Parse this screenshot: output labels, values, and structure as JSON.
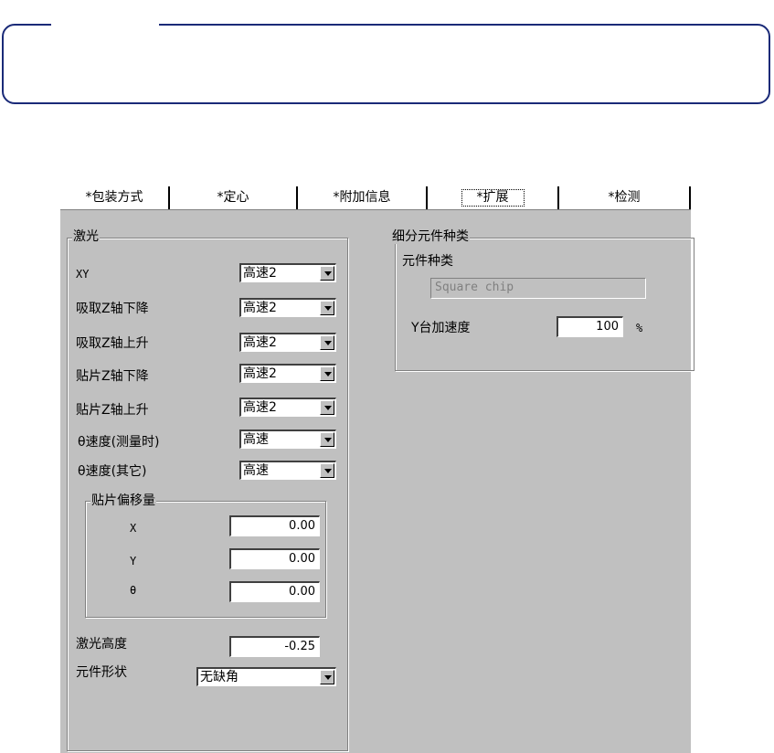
{
  "tabs": [
    {
      "label": "*包装方式"
    },
    {
      "label": "*定心"
    },
    {
      "label": "*附加信息"
    },
    {
      "label": "*扩展",
      "active": true
    },
    {
      "label": "*检测"
    }
  ],
  "laser": {
    "title": "激光",
    "rows": [
      {
        "label": "XY",
        "value": "高速2"
      },
      {
        "label": "吸取Z轴下降",
        "value": "高速2"
      },
      {
        "label": "吸取Z轴上升",
        "value": "高速2"
      },
      {
        "label": "贴片Z轴下降",
        "value": "高速2"
      },
      {
        "label": "贴片Z轴上升",
        "value": "高速2"
      },
      {
        "label": "θ速度(测量时)",
        "value": "高速"
      },
      {
        "label": "θ速度(其它)",
        "value": "高速"
      }
    ],
    "offset": {
      "title": "贴片偏移量",
      "x_label": "X",
      "x_value": "0.00",
      "y_label": "Y",
      "y_value": "0.00",
      "t_label": "θ",
      "t_value": "0.00"
    },
    "height_label": "激光高度",
    "height_value": "-0.25",
    "shape_label": "元件形状",
    "shape_value": "无缺角"
  },
  "subdivision": {
    "title": "细分元件种类",
    "type_label": "元件种类",
    "type_value": "Square chip",
    "accel_label": "Y台加速度",
    "accel_value": "100",
    "accel_unit": "%"
  }
}
